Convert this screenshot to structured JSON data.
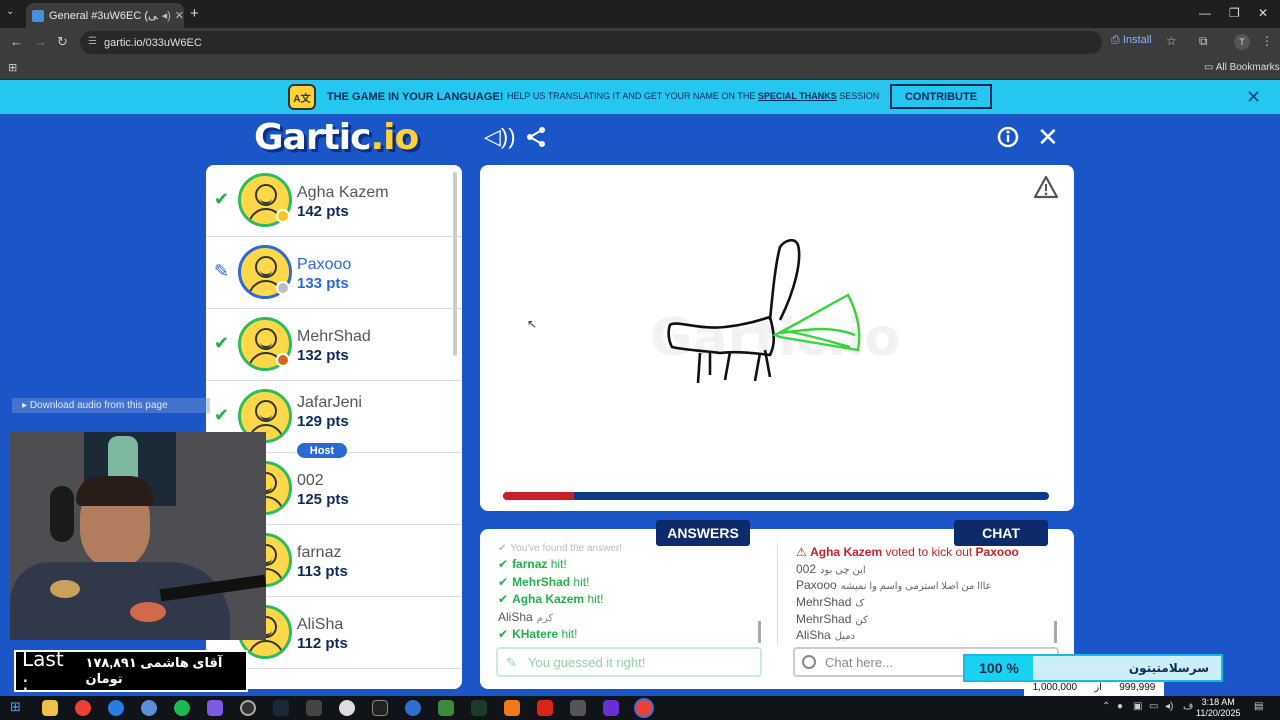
{
  "browser": {
    "tab_title": "General #3uW6EC (فارسی)",
    "url": "gartic.io/033uW6EC",
    "install_label": "Install",
    "all_bookmarks": "All Bookmarks"
  },
  "banner": {
    "headline": "THE GAME IN YOUR LANGUAGE!",
    "text_pre": "HELP US TRANSLATING IT AND GET YOUR NAME ON THE",
    "text_link": "SPECIAL THANKS",
    "text_post": "SESSION",
    "contribute": "CONTRIBUTE"
  },
  "game": {
    "logo_main": "Gartic",
    "logo_suffix": ".io"
  },
  "players": [
    {
      "name": "Agha Kazem",
      "pts": "142 pts",
      "status": "check",
      "dot": "#f2c81e",
      "highlight": false
    },
    {
      "name": "Paxooo",
      "pts": "133 pts",
      "status": "pen",
      "dot": "#bdbdbd",
      "highlight": true
    },
    {
      "name": "MehrShad",
      "pts": "132 pts",
      "status": "check",
      "dot": "#d06a1a",
      "highlight": false
    },
    {
      "name": "JafarJeni",
      "pts": "129 pts",
      "status": "check",
      "dot": "",
      "highlight": false,
      "host": "Host"
    },
    {
      "name": "002",
      "pts": "125 pts",
      "status": "",
      "dot": "",
      "highlight": false
    },
    {
      "name": "farnaz",
      "pts": "113 pts",
      "status": "",
      "dot": "",
      "highlight": false
    },
    {
      "name": "AliSha",
      "pts": "112 pts",
      "status": "",
      "dot": "",
      "highlight": false
    }
  ],
  "timer": {
    "remaining_fraction": 0.13
  },
  "answers": {
    "title": "ANSWERS",
    "faded_line": "You've found the answer!",
    "items": [
      {
        "name": "farnaz",
        "suffix": "hit!"
      },
      {
        "name": "MehrShad",
        "suffix": "hit!"
      },
      {
        "name": "Agha Kazem",
        "suffix": "hit!"
      },
      {
        "plain": "AliSha",
        "sub": "کرم"
      },
      {
        "name": "KHatere",
        "suffix": "hit!"
      }
    ],
    "input_placeholder": "You guessed it right!"
  },
  "chat": {
    "title": "CHAT",
    "kick": {
      "actor": "Agha Kazem",
      "text": "voted to kick out",
      "target": "Paxooo"
    },
    "messages": [
      {
        "name": "002",
        "text": "این چی بود"
      },
      {
        "name": "Paxooo",
        "text": "عااا من اصلا استرمی واسم وا نمیشه"
      },
      {
        "name": "MehrShad",
        "text": "ک"
      },
      {
        "name": "MehrShad",
        "text": "کن"
      },
      {
        "name": "AliSha",
        "text": "دمبل"
      }
    ],
    "input_placeholder": "Chat here..."
  },
  "overlays": {
    "download_audio": "Download audio from this page",
    "donation_last": "Last :",
    "donation_text": "آقای هاشمی ۱۷۸,۸۹۱ تومان",
    "goal_percent": "100 %",
    "goal_title": "سرسلامتیتون",
    "goal_target": "1,000,000",
    "goal_sep": "از",
    "goal_current": "999,999"
  },
  "taskbar": {
    "time": "3:18 AM",
    "date": "11/20/2025"
  },
  "colors": {
    "bg": "#1a56c8",
    "banner": "#25c6f0",
    "navy": "#0d2b6a",
    "green_hit": "#20b14a",
    "timer_red": "#c8202c",
    "drawing_green": "#34d63a"
  }
}
